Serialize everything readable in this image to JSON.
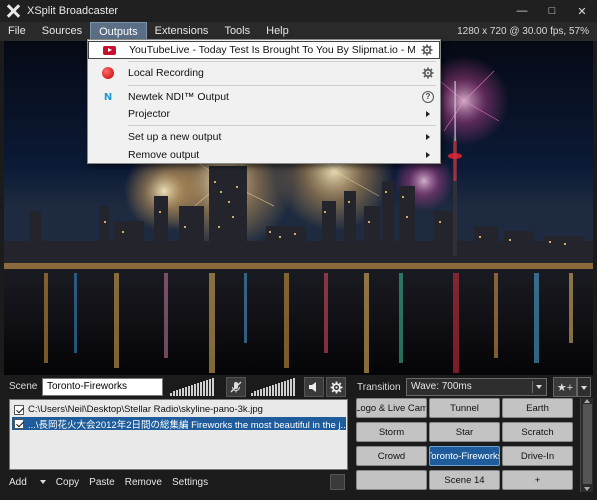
{
  "window": {
    "title": "XSplit Broadcaster",
    "controls": {
      "minimize": "—",
      "maximize": "□",
      "close": "✕"
    }
  },
  "menubar": {
    "items": [
      "File",
      "Sources",
      "Outputs",
      "Extensions",
      "Tools",
      "Help"
    ],
    "active": "Outputs",
    "resolution_info": "1280 x 720 @ 30.00 fps, 57%"
  },
  "outputs_menu": {
    "items": [
      {
        "label": "YouTubeLive - Today Test Is Brought To You By Slipmat.io - Music",
        "icon": "youtube-icon",
        "right": "gear-icon",
        "selected": true
      },
      {
        "label": "Local Recording",
        "icon": "record-icon",
        "right": "gear-icon"
      },
      {
        "label": "Newtek NDI™ Output",
        "icon": "ndi-icon",
        "right": "help-icon"
      },
      {
        "label": "Projector",
        "icon": "",
        "right": "submenu-arrow-icon"
      },
      {
        "label": "Set up a new output",
        "icon": "",
        "right": "submenu-arrow-icon"
      },
      {
        "label": "Remove output",
        "icon": "",
        "right": "submenu-arrow-icon"
      }
    ],
    "ndi_glyph": "N"
  },
  "scene_bar": {
    "label": "Scene",
    "name": "Toronto-Fireworks",
    "mic_icon": "mic-muted-icon",
    "speaker_icon": "speaker-icon",
    "settings_icon": "gear-icon"
  },
  "sources": {
    "items": [
      {
        "checked": true,
        "text": "C:\\Users\\Neil\\Desktop\\Stellar Radio\\skyline-pano-3k.jpg",
        "selected": false
      },
      {
        "checked": true,
        "text": "...\\長岡花火大会2012年2日間の総集編 Fireworks the most beautiful in the j...",
        "selected": true
      }
    ],
    "toolbar": {
      "add": "Add",
      "copy": "Copy",
      "paste": "Paste",
      "remove": "Remove",
      "settings": "Settings"
    }
  },
  "transition": {
    "label": "Transition",
    "value": "Wave: 700ms",
    "add_scene_glyph": "★+"
  },
  "scenes": {
    "buttons": [
      "Logo & Live Cam",
      "Tunnel",
      "Earth",
      "Storm",
      "Star",
      "Scratch",
      "Crowd",
      "Toronto-Fireworks",
      "Drive-In",
      "",
      "Scene 14",
      "+"
    ],
    "active_index": 7
  },
  "colors": {
    "accent": "#1e5c9b",
    "menu_active": "#5a6e85",
    "youtube_red": "#c8102e",
    "record_red": "#c40000",
    "ndi_blue": "#1e9ad6"
  }
}
